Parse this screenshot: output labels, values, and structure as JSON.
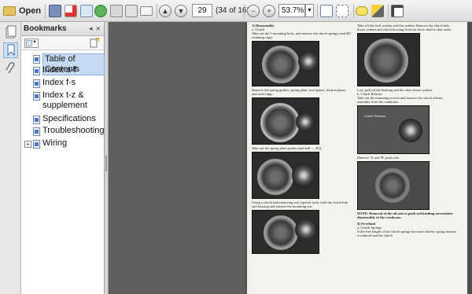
{
  "toolbar": {
    "open_label": "Open",
    "page_number": "29",
    "page_count": "(34 of 163)",
    "zoom_value": "53.7%",
    "zoom_minus": "−",
    "zoom_plus": "+",
    "icons": [
      "open-folder",
      "print",
      "create",
      "upload",
      "save",
      "print2",
      "email",
      "prev-page",
      "next-page",
      "zoom-out",
      "zoom-in",
      "zoom-dropdown",
      "fit-page",
      "fit-width",
      "comment",
      "highlight",
      "fullscreen"
    ]
  },
  "panel": {
    "title": "Bookmarks",
    "close": "×",
    "items": [
      {
        "label": "Table of Contents",
        "expand": "",
        "selected": true
      },
      {
        "label": "Index a-f",
        "expand": ""
      },
      {
        "label": "Index f-s",
        "expand": ""
      },
      {
        "label": "Index t-z & supplement",
        "expand": ""
      },
      {
        "label": "Specifications",
        "expand": ""
      },
      {
        "label": "Troubleshooting",
        "expand": ""
      },
      {
        "label": "Wiring",
        "expand": "+"
      }
    ]
  },
  "doc": {
    "left": {
      "heading": "1) Disassembly",
      "sub": "a. Clutch",
      "p1": "Take out the 5 mounting bolts, and remove the clutch springs (and H2 retaining ring).",
      "cap1": "Remove the spring guides, spring plate, steel plates, friction plates and steel rings.",
      "cap2": "Take out the spring plate pusher (and ball — H2).",
      "cap3": "Using a clutch hub removing tool (special tool), hold the clutch hub and housing and remove the mounting nut."
    },
    "right": {
      "p1": "Take off the lock washer and flat washer. Remove the clutch hub, thrust washer and clutch housing from the drive shaft in that order.",
      "cap1": "Last, pull off the bushing and the other thrust washer.",
      "sub2": "b. Clutch Release",
      "p2": "Take out the mounting screws and remove the clutch release assembly from the crankcase.",
      "photo_label": "Clutch Release",
      "cap2": "Remove 'A' and 'B' push rods.",
      "note": "NOTE: Removal of the oil seal so push rod bushing necessitates disassembly of the crankcase.",
      "heading3": "4) Overhaul",
      "sub3": "a. Clutch Springs",
      "p3": "If the free length of the clutch springs becomes shorter, spring tension is reduced and the clutch"
    }
  }
}
